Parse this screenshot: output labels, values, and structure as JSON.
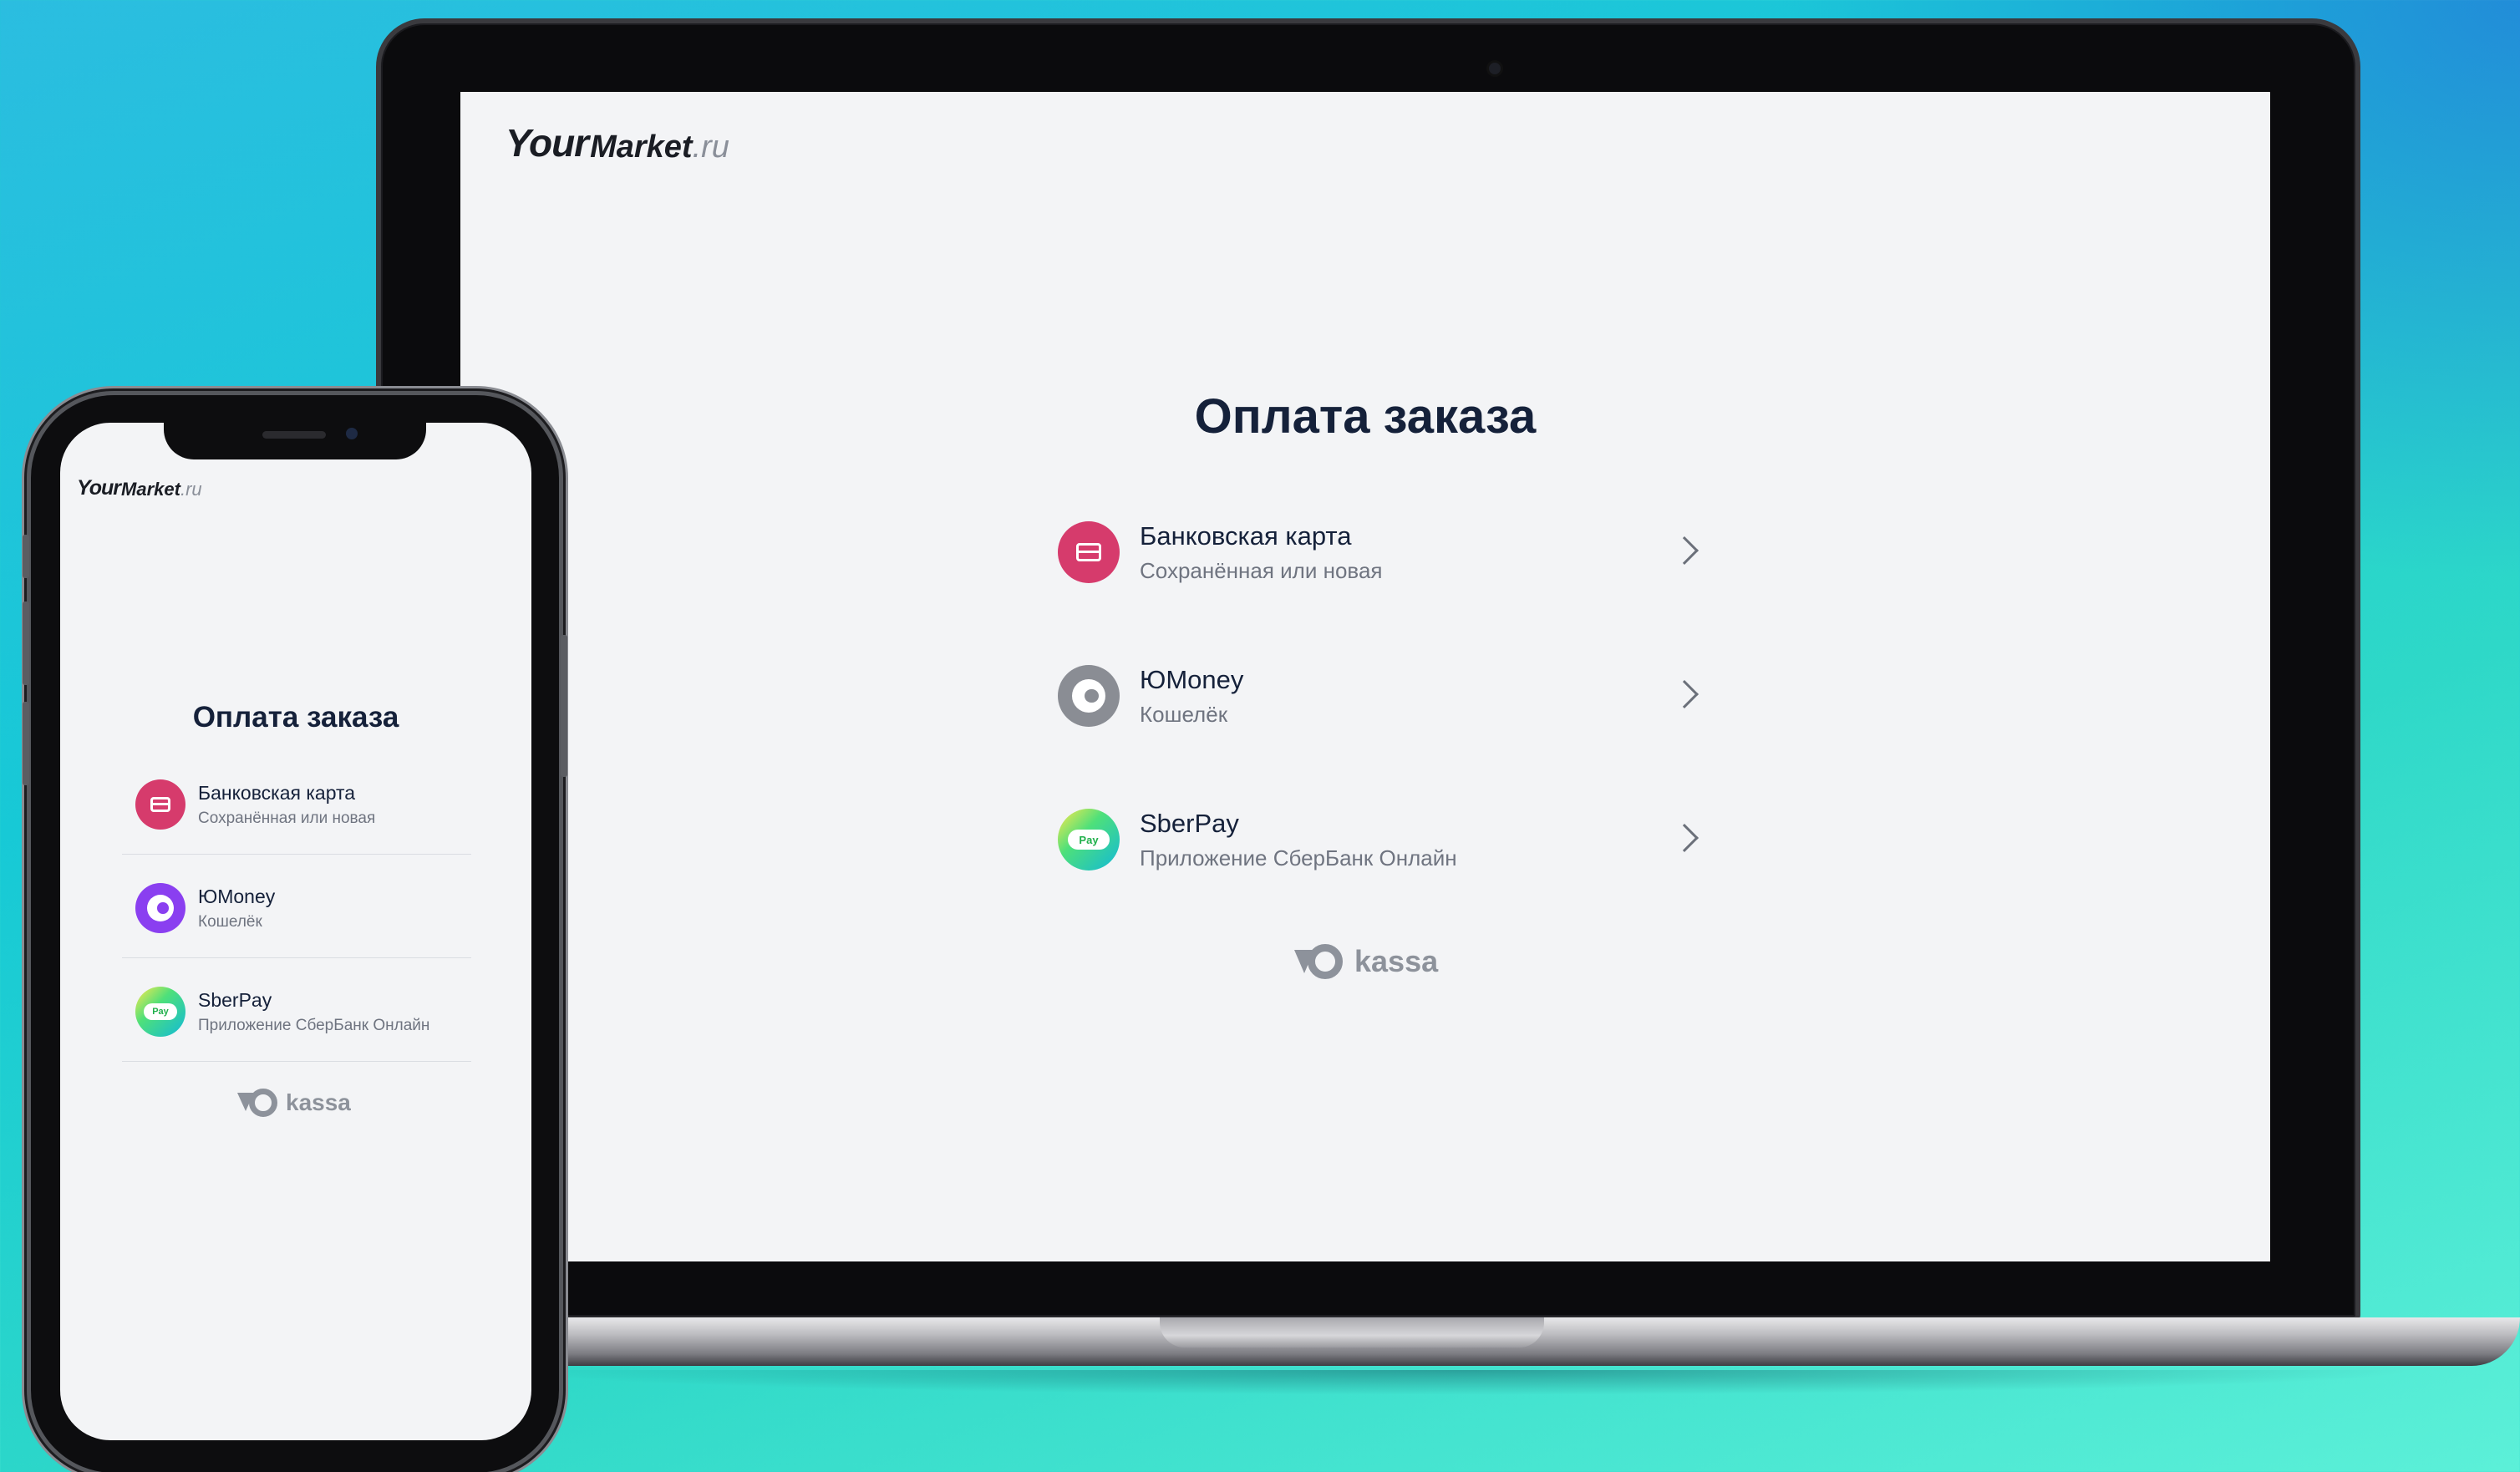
{
  "brand": {
    "your": "Your",
    "market": "Market",
    "ru": ".ru"
  },
  "checkout": {
    "title": "Оплата заказа",
    "methods": [
      {
        "name": "Банковская карта",
        "subtitle": "Сохранённая или новая",
        "icon": "bank-card-icon"
      },
      {
        "name": "ЮMoney",
        "subtitle": "Кошелёк",
        "icon": "yoomoney-icon"
      },
      {
        "name": "SberPay",
        "subtitle": "Приложение СберБанк Онлайн",
        "icon": "sberpay-icon"
      }
    ],
    "sber_badge": "Pay",
    "footer_brand": "kassa"
  },
  "colors": {
    "card": "#d63b6c",
    "yoomoney_desktop": "#8a8d94",
    "yoomoney_mobile": "#8a3ff0",
    "title": "#15213a"
  }
}
